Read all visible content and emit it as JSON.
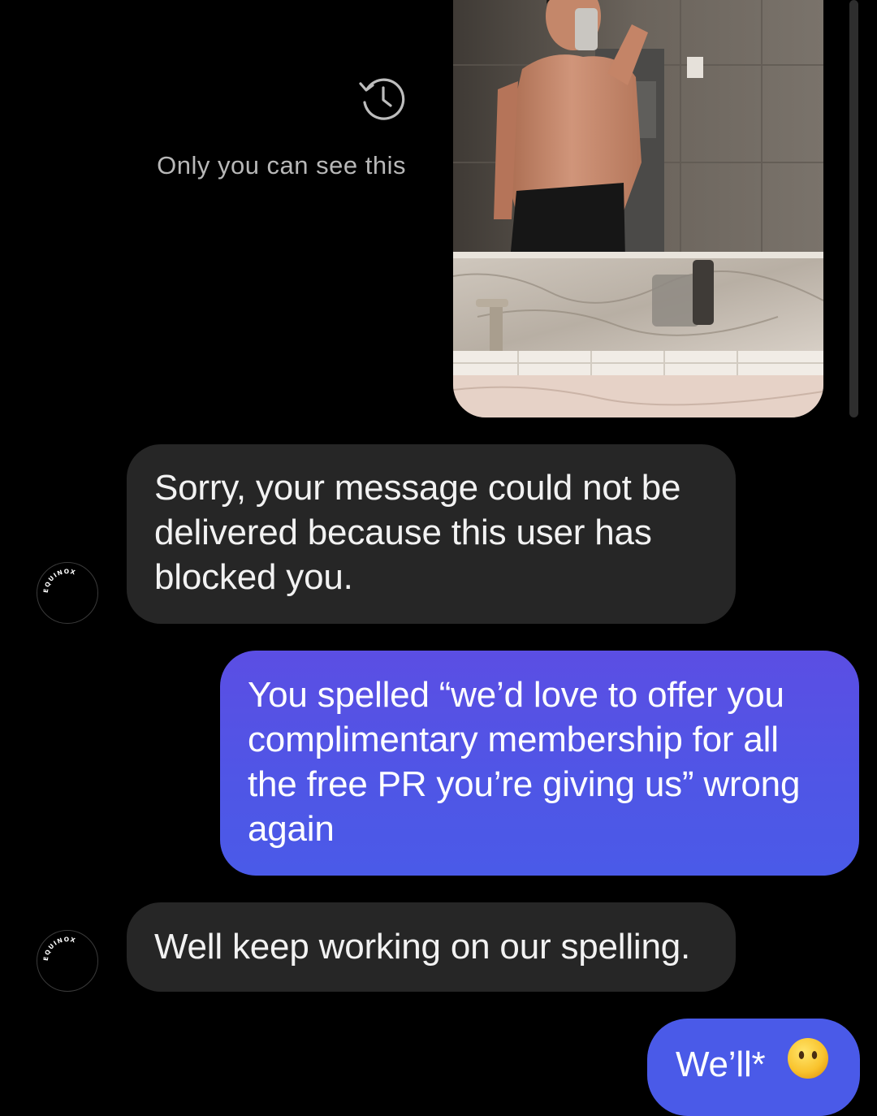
{
  "vanish_mode": {
    "icon": "history-icon",
    "notice": "Only you can see this"
  },
  "photo": {
    "icon": "mirror-selfie-photo"
  },
  "contact": {
    "avatar_text": "EQUINOX"
  },
  "messages": [
    {
      "sender": "them",
      "text": "Sorry, your message could not be delivered because this user has blocked you."
    },
    {
      "sender": "me",
      "text": "You spelled “we’d love to offer you complimentary membership for all the free PR you’re giving us” wrong again"
    },
    {
      "sender": "them",
      "text": "Well keep working on our spelling."
    },
    {
      "sender": "me",
      "text": "We’ll*",
      "emoji": "face-without-mouth-emoji"
    }
  ],
  "colors": {
    "background": "#000000",
    "incoming_bubble": "#262626",
    "outgoing_bubble": "#4f56e6",
    "notice_text": "#b8b8b8"
  }
}
